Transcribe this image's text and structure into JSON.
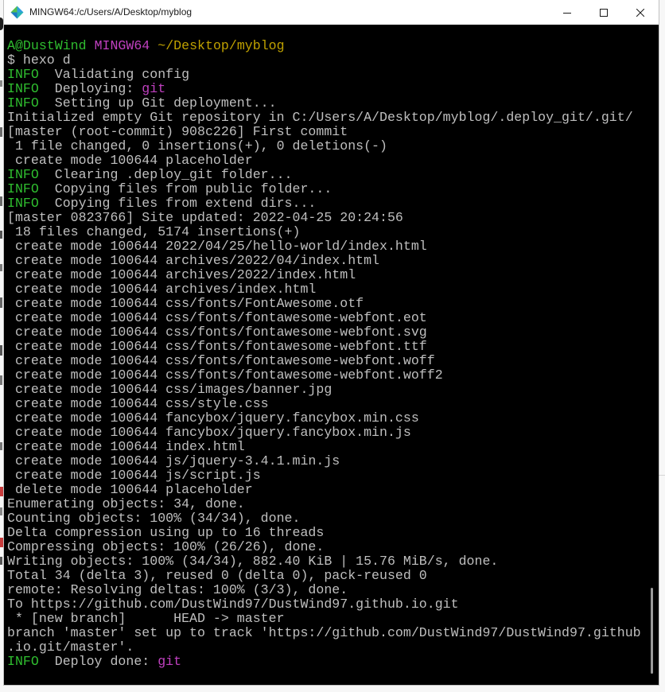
{
  "window": {
    "title": "MINGW64:/c/Users/A/Desktop/myblog",
    "app_icon": "mingw64-icon",
    "controls": {
      "minimize": "minimize-icon",
      "maximize": "maximize-icon",
      "close": "close-icon"
    }
  },
  "terminal": {
    "palette": {
      "background": "#000000",
      "default": "#bfbfbf",
      "green": "#2fbd2f",
      "magenta": "#bf40bf",
      "yellow": "#bfa100"
    },
    "lines": [
      [],
      [
        {
          "text": "A@DustWind",
          "color": "green"
        },
        {
          "text": " "
        },
        {
          "text": "MINGW64",
          "color": "magenta"
        },
        {
          "text": " "
        },
        {
          "text": "~/Desktop/myblog",
          "color": "yellow"
        }
      ],
      [
        {
          "text": "$ hexo d"
        }
      ],
      [
        {
          "text": "INFO",
          "color": "green"
        },
        {
          "text": "  Validating config"
        }
      ],
      [
        {
          "text": "INFO",
          "color": "green"
        },
        {
          "text": "  Deploying: "
        },
        {
          "text": "git",
          "color": "magenta"
        }
      ],
      [
        {
          "text": "INFO",
          "color": "green"
        },
        {
          "text": "  Setting up Git deployment..."
        }
      ],
      [
        {
          "text": "Initialized empty Git repository in C:/Users/A/Desktop/myblog/.deploy_git/.git/"
        }
      ],
      [
        {
          "text": "[master (root-commit) 908c226] First commit"
        }
      ],
      [
        {
          "text": " 1 file changed, 0 insertions(+), 0 deletions(-)"
        }
      ],
      [
        {
          "text": " create mode 100644 placeholder"
        }
      ],
      [
        {
          "text": "INFO",
          "color": "green"
        },
        {
          "text": "  Clearing .deploy_git folder..."
        }
      ],
      [
        {
          "text": "INFO",
          "color": "green"
        },
        {
          "text": "  Copying files from public folder..."
        }
      ],
      [
        {
          "text": "INFO",
          "color": "green"
        },
        {
          "text": "  Copying files from extend dirs..."
        }
      ],
      [
        {
          "text": "[master 0823766] Site updated: 2022-04-25 20:24:56"
        }
      ],
      [
        {
          "text": " 18 files changed, 5174 insertions(+)"
        }
      ],
      [
        {
          "text": " create mode 100644 2022/04/25/hello-world/index.html"
        }
      ],
      [
        {
          "text": " create mode 100644 archives/2022/04/index.html"
        }
      ],
      [
        {
          "text": " create mode 100644 archives/2022/index.html"
        }
      ],
      [
        {
          "text": " create mode 100644 archives/index.html"
        }
      ],
      [
        {
          "text": " create mode 100644 css/fonts/FontAwesome.otf"
        }
      ],
      [
        {
          "text": " create mode 100644 css/fonts/fontawesome-webfont.eot"
        }
      ],
      [
        {
          "text": " create mode 100644 css/fonts/fontawesome-webfont.svg"
        }
      ],
      [
        {
          "text": " create mode 100644 css/fonts/fontawesome-webfont.ttf"
        }
      ],
      [
        {
          "text": " create mode 100644 css/fonts/fontawesome-webfont.woff"
        }
      ],
      [
        {
          "text": " create mode 100644 css/fonts/fontawesome-webfont.woff2"
        }
      ],
      [
        {
          "text": " create mode 100644 css/images/banner.jpg"
        }
      ],
      [
        {
          "text": " create mode 100644 css/style.css"
        }
      ],
      [
        {
          "text": " create mode 100644 fancybox/jquery.fancybox.min.css"
        }
      ],
      [
        {
          "text": " create mode 100644 fancybox/jquery.fancybox.min.js"
        }
      ],
      [
        {
          "text": " create mode 100644 index.html"
        }
      ],
      [
        {
          "text": " create mode 100644 js/jquery-3.4.1.min.js"
        }
      ],
      [
        {
          "text": " create mode 100644 js/script.js"
        }
      ],
      [
        {
          "text": " delete mode 100644 placeholder"
        }
      ],
      [
        {
          "text": "Enumerating objects: 34, done."
        }
      ],
      [
        {
          "text": "Counting objects: 100% (34/34), done."
        }
      ],
      [
        {
          "text": "Delta compression using up to 16 threads"
        }
      ],
      [
        {
          "text": "Compressing objects: 100% (26/26), done."
        }
      ],
      [
        {
          "text": "Writing objects: 100% (34/34), 882.40 KiB | 15.76 MiB/s, done."
        }
      ],
      [
        {
          "text": "Total 34 (delta 3), reused 0 (delta 0), pack-reused 0"
        }
      ],
      [
        {
          "text": "remote: Resolving deltas: 100% (3/3), done."
        }
      ],
      [
        {
          "text": "To https://github.com/DustWind97/DustWind97.github.io.git"
        }
      ],
      [
        {
          "text": " * [new branch]      HEAD -> master"
        }
      ],
      [
        {
          "text": "branch 'master' set up to track 'https://github.com/DustWind97/DustWind97.github"
        }
      ],
      [
        {
          "text": ".io.git/master'."
        }
      ],
      [
        {
          "text": "INFO",
          "color": "green"
        },
        {
          "text": "  Deploy done: "
        },
        {
          "text": "git",
          "color": "magenta"
        }
      ]
    ],
    "scrollbar": {
      "visible_fraction": 0.13,
      "scroll_fraction": 0.98
    }
  }
}
